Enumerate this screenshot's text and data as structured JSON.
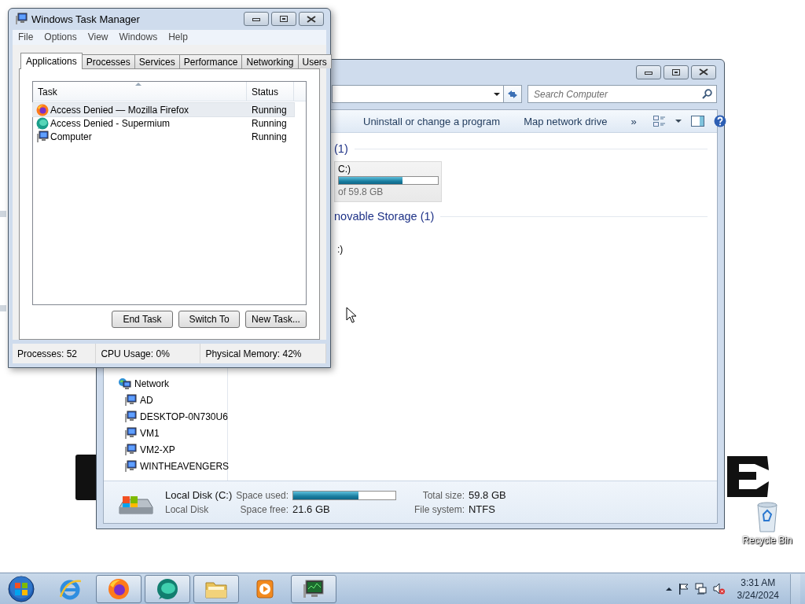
{
  "task_manager": {
    "title": "Windows Task Manager",
    "menu": [
      "File",
      "Options",
      "View",
      "Windows",
      "Help"
    ],
    "tabs": [
      {
        "label": "Applications",
        "selected": true
      },
      {
        "label": "Processes",
        "selected": false
      },
      {
        "label": "Services",
        "selected": false
      },
      {
        "label": "Performance",
        "selected": false
      },
      {
        "label": "Networking",
        "selected": false
      },
      {
        "label": "Users",
        "selected": false
      }
    ],
    "columns": [
      "Task",
      "Status"
    ],
    "rows": [
      {
        "kind": "firefox",
        "task": "Access Denied — Mozilla Firefox",
        "status": "Running",
        "selected": true
      },
      {
        "kind": "supermium",
        "task": "Access Denied - Supermium",
        "status": "Running",
        "selected": false
      },
      {
        "kind": "computer",
        "task": "Computer",
        "status": "Running",
        "selected": false
      }
    ],
    "buttons": [
      "End Task",
      "Switch To",
      "New Task..."
    ],
    "status_bar": [
      "Processes: 52",
      "CPU Usage: 0%",
      "Physical Memory: 42%"
    ]
  },
  "explorer": {
    "search": {
      "placeholder": "Search Computer"
    },
    "toolbar": [
      "Uninstall or change a program",
      "Map network drive",
      "»"
    ],
    "groups": [
      {
        "header": "(1)",
        "drives": [
          {
            "name": "C:)",
            "level": 0.64,
            "caption": "of 59.8 GB"
          }
        ]
      },
      {
        "header": "novable Storage (1)",
        "drives": [
          {
            "name": ":)"
          }
        ]
      }
    ],
    "navigation": {
      "label": "Network",
      "children": [
        {
          "label": "AD"
        },
        {
          "label": "DESKTOP-0N730U6"
        },
        {
          "label": "VM1"
        },
        {
          "label": "VM2-XP"
        },
        {
          "label": "WINTHEAVENGERS"
        }
      ]
    },
    "details": {
      "name": "Local Disk (C:)",
      "type": "Local Disk",
      "space_used_label": "Space used:",
      "level": 0.64,
      "space_free_label": "Space free:",
      "space_free": "21.6 GB",
      "total_size_label": "Total size:",
      "total_size": "59.8 GB",
      "file_system_label": "File system:",
      "file_system": "NTFS"
    }
  },
  "desktop": {
    "icons": [
      {
        "label": "Recycle Bin"
      }
    ]
  },
  "taskbar": {
    "buttons": [
      {
        "kind": "ie",
        "running": false
      },
      {
        "kind": "firefox",
        "running": true
      },
      {
        "kind": "supermium",
        "running": true
      },
      {
        "kind": "folder",
        "running": true
      },
      {
        "kind": "media",
        "running": false
      },
      {
        "kind": "monitor",
        "running": true
      }
    ],
    "time": "3:31 AM",
    "date": "3/24/2024"
  }
}
